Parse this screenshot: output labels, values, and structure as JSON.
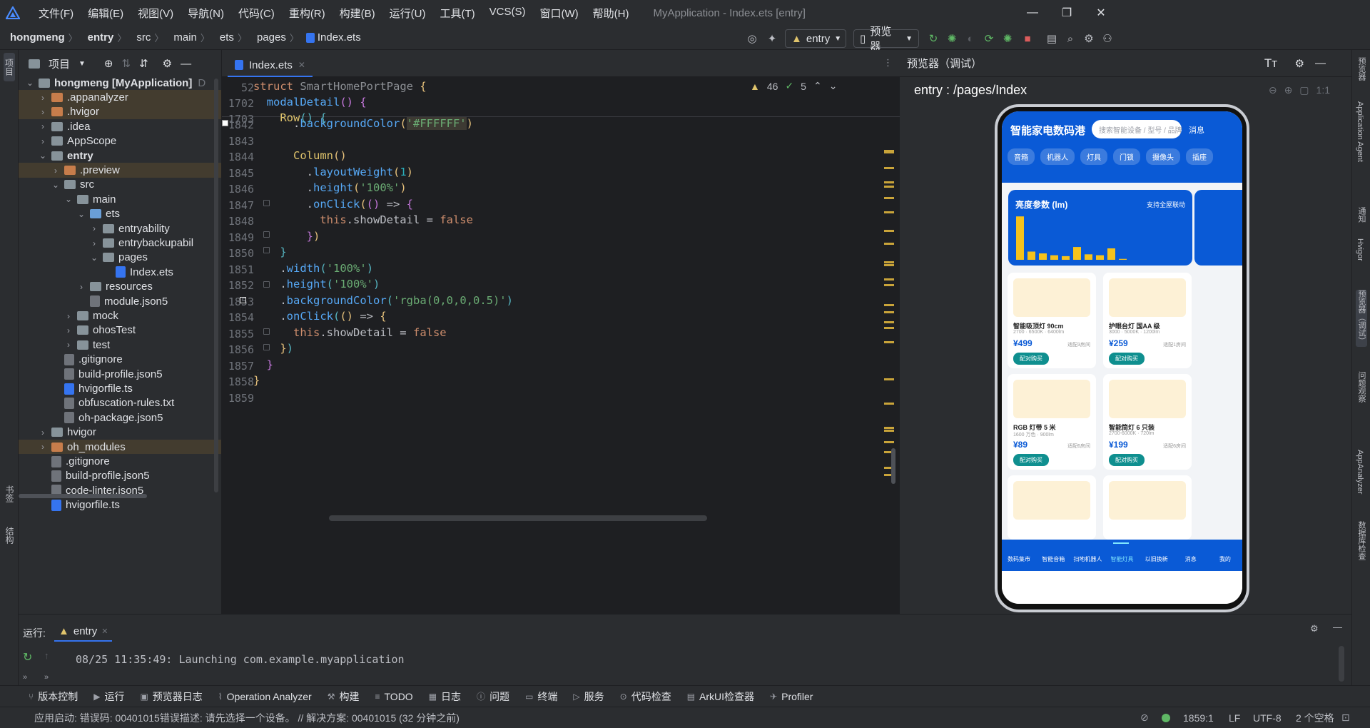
{
  "menubar": {
    "items": [
      "文件(F)",
      "编辑(E)",
      "视图(V)",
      "导航(N)",
      "代码(C)",
      "重构(R)",
      "构建(B)",
      "运行(U)",
      "工具(T)",
      "VCS(S)",
      "窗口(W)",
      "帮助(H)"
    ],
    "title": "MyApplication - Index.ets [entry]"
  },
  "navbar": {
    "crumbs": [
      "hongmeng",
      "entry",
      "src",
      "main",
      "ets",
      "pages",
      "Index.ets"
    ],
    "run_config": "entry",
    "device": "预览器"
  },
  "left_strip": {
    "project_label": "项目",
    "bookmarks_label": "书签",
    "structure_label": "结构"
  },
  "project_panel": {
    "title": "项目",
    "rows": [
      {
        "label": "hongmeng [MyApplication]",
        "suffix": "D",
        "depth": 0,
        "expanded": true,
        "icon": "folder-blue",
        "state": ""
      },
      {
        "label": ".appanalyzer",
        "depth": 1,
        "expanded": false,
        "icon": "folder-orange",
        "state": "hl"
      },
      {
        "label": ".hvigor",
        "depth": 1,
        "expanded": false,
        "icon": "folder-orange",
        "state": "hl"
      },
      {
        "label": ".idea",
        "depth": 1,
        "expanded": false,
        "icon": "folder-blue",
        "state": ""
      },
      {
        "label": "AppScope",
        "depth": 1,
        "expanded": false,
        "icon": "folder-blue",
        "state": ""
      },
      {
        "label": "entry",
        "depth": 1,
        "expanded": true,
        "icon": "folder-blue",
        "state": "",
        "bold": true
      },
      {
        "label": ".preview",
        "depth": 2,
        "expanded": false,
        "icon": "folder-orange",
        "state": "hl"
      },
      {
        "label": "src",
        "depth": 2,
        "expanded": true,
        "icon": "folder-blue",
        "state": ""
      },
      {
        "label": "main",
        "depth": 3,
        "expanded": true,
        "icon": "folder-blue",
        "state": ""
      },
      {
        "label": "ets",
        "depth": 4,
        "expanded": true,
        "icon": "folder-src",
        "state": ""
      },
      {
        "label": "entryability",
        "depth": 5,
        "expanded": false,
        "icon": "folder-blue",
        "state": ""
      },
      {
        "label": "entrybackupabil",
        "depth": 5,
        "expanded": false,
        "icon": "folder-blue",
        "state": ""
      },
      {
        "label": "pages",
        "depth": 5,
        "expanded": true,
        "icon": "folder-blue",
        "state": ""
      },
      {
        "label": "Index.ets",
        "depth": 6,
        "leaf": true,
        "icon": "file-ts",
        "state": ""
      },
      {
        "label": "resources",
        "depth": 4,
        "expanded": false,
        "icon": "folder-blue",
        "state": ""
      },
      {
        "label": "module.json5",
        "depth": 4,
        "leaf": true,
        "icon": "file",
        "state": ""
      },
      {
        "label": "mock",
        "depth": 3,
        "expanded": false,
        "icon": "folder-blue",
        "state": ""
      },
      {
        "label": "ohosTest",
        "depth": 3,
        "expanded": false,
        "icon": "folder-blue",
        "state": ""
      },
      {
        "label": "test",
        "depth": 3,
        "expanded": false,
        "icon": "folder-blue",
        "state": ""
      },
      {
        "label": ".gitignore",
        "depth": 2,
        "leaf": true,
        "icon": "file",
        "state": ""
      },
      {
        "label": "build-profile.json5",
        "depth": 2,
        "leaf": true,
        "icon": "file",
        "state": ""
      },
      {
        "label": "hvigorfile.ts",
        "depth": 2,
        "leaf": true,
        "icon": "file-ts",
        "state": ""
      },
      {
        "label": "obfuscation-rules.txt",
        "depth": 2,
        "leaf": true,
        "icon": "file",
        "state": ""
      },
      {
        "label": "oh-package.json5",
        "depth": 2,
        "leaf": true,
        "icon": "file",
        "state": ""
      },
      {
        "label": "hvigor",
        "depth": 1,
        "expanded": false,
        "icon": "folder-blue",
        "state": ""
      },
      {
        "label": "oh_modules",
        "depth": 1,
        "expanded": false,
        "icon": "folder-orange",
        "state": "hl"
      },
      {
        "label": ".gitignore",
        "depth": 1,
        "leaf": true,
        "icon": "file",
        "state": ""
      },
      {
        "label": "build-profile.json5",
        "depth": 1,
        "leaf": true,
        "icon": "file",
        "state": ""
      },
      {
        "label": "code-linter.json5",
        "depth": 1,
        "leaf": true,
        "icon": "file",
        "state": ""
      },
      {
        "label": "hvigorfile.ts",
        "depth": 1,
        "leaf": true,
        "icon": "file-ts",
        "state": ""
      }
    ]
  },
  "editor": {
    "tab_label": "Index.ets",
    "warnings": "46",
    "checks": "5",
    "sticky": [
      {
        "ln": "52",
        "html": "<span class='kw'>struct</span> <span class='ty' style='color:#8c8f94'>SmartHomePortPage</span> <span class='paren1'>{</span>"
      },
      {
        "ln": "1702",
        "html": "  <span class='fn'>modalDetail</span><span class='paren2'>()</span> <span class='paren2'>{</span>"
      },
      {
        "ln": "1703",
        "html": "    <span class='method'>Row</span><span class='paren3'>()</span> <span class='paren3'>{</span>"
      }
    ],
    "lines": [
      {
        "ln": "1842",
        "html": "      .<span class='fn'>backgroundColor</span><span class='paren1'>(</span><span class='str' style='background:#3d3a33'>'#FFFFFF'</span><span class='paren1'>)</span>"
      },
      {
        "ln": "1843",
        "html": ""
      },
      {
        "ln": "1844",
        "html": "      <span class='method'>Column</span><span class='paren1'>()</span>"
      },
      {
        "ln": "1845",
        "html": "        .<span class='fn'>layoutWeight</span><span class='paren1'>(</span><span class='num'>1</span><span class='paren1'>)</span>"
      },
      {
        "ln": "1846",
        "html": "        .<span class='fn'>height</span><span class='paren1'>(</span><span class='str'>'100%'</span><span class='paren1'>)</span>"
      },
      {
        "ln": "1847",
        "html": "        .<span class='fn'>onClick</span><span class='paren1'>(</span><span class='paren2'>()</span> => <span class='paren2'>{</span>"
      },
      {
        "ln": "1848",
        "html": "          <span class='this'>this</span>.showDetail = <span class='kw'>false</span>"
      },
      {
        "ln": "1849",
        "html": "        <span class='paren2'>}</span><span class='paren1'>)</span>"
      },
      {
        "ln": "1850",
        "html": "    <span class='paren3'>}</span>"
      },
      {
        "ln": "1851",
        "html": "    .<span class='fn'>width</span><span class='paren3'>(</span><span class='str'>'100%'</span><span class='paren3'>)</span>"
      },
      {
        "ln": "1852",
        "html": "    .<span class='fn'>height</span><span class='paren3'>(</span><span class='str'>'100%'</span><span class='paren3'>)</span>"
      },
      {
        "ln": "1853",
        "html": "    .<span class='fn'>backgroundColor</span><span class='paren3'>(</span><span class='str'>'rgba(0,0,0,0.5)'</span><span class='paren3'>)</span>"
      },
      {
        "ln": "1854",
        "html": "    .<span class='fn'>onClick</span><span class='paren3'>(</span><span class='paren1'>()</span> => <span class='paren1'>{</span>"
      },
      {
        "ln": "1855",
        "html": "      <span class='this'>this</span>.showDetail = <span class='kw'>false</span>"
      },
      {
        "ln": "1856",
        "html": "    <span class='paren1'>}</span><span class='paren3'>)</span>"
      },
      {
        "ln": "1857",
        "html": "  <span class='paren2'>}</span>"
      },
      {
        "ln": "1858",
        "html": "<span class='paren1'>}</span>"
      },
      {
        "ln": "1859",
        "html": ""
      }
    ]
  },
  "preview": {
    "header": "预览器（调试）",
    "path": "entry : /pages/Index",
    "app": {
      "title": "智能家电数码港",
      "search_placeholder": "搜索智能设备 / 型号 / 品牌",
      "msg": "消息",
      "chips": [
        "音箱",
        "机器人",
        "灯具",
        "门锁",
        "摄像头",
        "插座"
      ],
      "banner_title": "亮度参数 (lm)",
      "banner_note": "支持全屋联动",
      "bar_values": [
        0.95,
        0.18,
        0.14,
        0.1,
        0.08,
        0.28,
        0.12,
        0.1,
        0.25,
        0.02
      ],
      "products": [
        {
          "name": "智能吸顶灯 90cm",
          "spec": "2700 · 6500K · 6400lm",
          "price": "¥499",
          "note": "适配3房间",
          "btn": "配对购买"
        },
        {
          "name": "护眼台灯 国AA 级",
          "spec": "3000 · 5000K · 1200lm",
          "price": "¥259",
          "note": "适配1房间",
          "btn": "配对购买"
        },
        {
          "name": "RGB 灯带 5 米",
          "spec": "1600 万色 · 900lm",
          "price": "¥89",
          "note": "适配6房间",
          "btn": "配对购买"
        },
        {
          "name": "智能筒灯 6 只装",
          "spec": "2700-6000K · 720lm",
          "price": "¥199",
          "note": "适配6房间",
          "btn": "配对购买"
        }
      ],
      "tabs": [
        "数码集市",
        "智能音箱",
        "扫地机器人",
        "智能灯具",
        "以旧换新",
        "消息",
        "我的"
      ],
      "active_tab": 3
    }
  },
  "right_strip": [
    "预览器",
    "Application Agent",
    "通知",
    "Hvigor",
    "预览器（调试）",
    "问题观察",
    "AppAnalyzer",
    "数据库检查"
  ],
  "run_panel": {
    "label": "运行:",
    "tab": "entry",
    "log": "08/25 11:35:49: Launching com.example.myapplication"
  },
  "bottom_bar": [
    {
      "label": "版本控制",
      "icon": "git-icon"
    },
    {
      "label": "运行",
      "icon": "run-icon"
    },
    {
      "label": "预览器日志",
      "icon": "preview-log-icon"
    },
    {
      "label": "Operation Analyzer",
      "icon": "chart-icon"
    },
    {
      "label": "构建",
      "icon": "hammer-icon"
    },
    {
      "label": "TODO",
      "icon": "list-icon"
    },
    {
      "label": "日志",
      "icon": "log-icon"
    },
    {
      "label": "问题",
      "icon": "info-icon"
    },
    {
      "label": "终端",
      "icon": "terminal-icon"
    },
    {
      "label": "服务",
      "icon": "services-icon"
    },
    {
      "label": "代码检查",
      "icon": "inspect-icon"
    },
    {
      "label": "ArkUI检查器",
      "icon": "arkui-icon"
    },
    {
      "label": "Profiler",
      "icon": "profiler-icon"
    }
  ],
  "status_bar": {
    "message": "应用启动: 错误码: 00401015错误描述: 请先选择一个设备。 // 解决方案: 00401015 (32 分钟之前)",
    "position": "1859:1",
    "line_sep": "LF",
    "encoding": "UTF-8",
    "indent": "2 个空格"
  },
  "colors": {
    "accent": "#3574f0",
    "app_blue": "#0a5ad6",
    "bar_yellow": "#f6c21c",
    "teal_btn": "#0f8f8f"
  }
}
